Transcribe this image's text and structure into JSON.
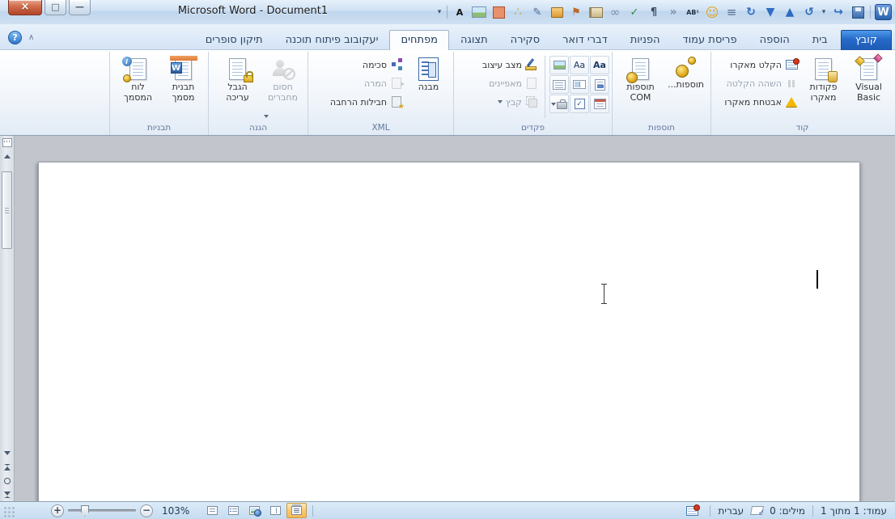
{
  "window": {
    "title": "Microsoft Word - Document1",
    "controls": {
      "close": "×",
      "maximize": "□",
      "minimize": "—"
    }
  },
  "glyphs": {
    "w": "W",
    "aa": "Aa",
    "check": "✓",
    "help": "?",
    "collapse": "∧",
    "plus": "+",
    "minus": "−",
    "i": "i",
    "star": "★"
  },
  "qat": {
    "icons": [
      {
        "name": "toolbar-options",
        "glyph": "▾"
      },
      {
        "name": "font-color",
        "glyph": "A"
      },
      {
        "name": "picture",
        "glyph": ""
      },
      {
        "name": "shape",
        "glyph": ""
      },
      {
        "name": "org-chart",
        "glyph": "∴"
      },
      {
        "name": "ink-signature",
        "glyph": "✎"
      },
      {
        "name": "package",
        "glyph": ""
      },
      {
        "name": "signpost",
        "glyph": "⚑"
      },
      {
        "name": "book",
        "glyph": ""
      },
      {
        "name": "rings",
        "glyph": "∞"
      },
      {
        "name": "hyperlink-check",
        "glyph": "✓"
      },
      {
        "name": "paragraph-marks",
        "glyph": "¶"
      },
      {
        "name": "autotext",
        "glyph": "»"
      },
      {
        "name": "footnote",
        "glyph": "AB¹"
      },
      {
        "name": "emoticon",
        "glyph": "☺"
      },
      {
        "name": "line-spacing",
        "glyph": "≡"
      },
      {
        "name": "sync",
        "glyph": "↻"
      },
      {
        "name": "move-down",
        "glyph": "▼"
      },
      {
        "name": "move-up",
        "glyph": "▲"
      },
      {
        "name": "undo",
        "glyph": "↺"
      },
      {
        "name": "undo-menu",
        "glyph": "▾"
      },
      {
        "name": "redo",
        "glyph": "↪"
      },
      {
        "name": "save",
        "glyph": ""
      }
    ]
  },
  "tabs": [
    {
      "label": "קובץ"
    },
    {
      "label": "בית"
    },
    {
      "label": "הוספה"
    },
    {
      "label": "פריסת עמוד"
    },
    {
      "label": "הפניות"
    },
    {
      "label": "דברי דואר"
    },
    {
      "label": "סקירה"
    },
    {
      "label": "תצוגה"
    },
    {
      "label": "מפתחים",
      "active": true
    },
    {
      "label": "יעקובוב פיתוח תוכנה"
    },
    {
      "label": "תיקון סופרים"
    }
  ],
  "ribbon": {
    "code": {
      "label": "קוד",
      "visual_basic": "Visual Basic",
      "macros": "פקודות מאקרו",
      "record_macro": "הקלט מאקרו",
      "pause_recording": "השהה הקלטה",
      "macro_security": "אבטחת מאקרו"
    },
    "addins": {
      "label": "תוספות",
      "addins": "תוספות...",
      "com_addins": "תוספות COM"
    },
    "controls": {
      "label": "פקדים",
      "design_mode": "מצב עיצוב",
      "properties": "מאפיינים",
      "group": "קבץ"
    },
    "xml": {
      "label": "XML",
      "structure": "מבנה",
      "schema": "סכימה",
      "transformation": "המרה",
      "expansion_packs": "חבילות הרחבה"
    },
    "protection": {
      "label": "הגנה",
      "block_authors": "חסום מחברים",
      "restrict_editing": "הגבל עריכה"
    },
    "templates": {
      "label": "תבניות",
      "document_template": "תבנית מסמך",
      "document_panel": "לוח המסמך"
    }
  },
  "statusbar": {
    "page_info": "עמוד: 1 מתוך 1",
    "words": "מילים: 0",
    "language": "עברית",
    "zoom": "103%"
  },
  "colors": {
    "file_tab_blue": "#2a72cd",
    "close_button_red": "#c75b40",
    "active_view_orange": "#f6c066",
    "ribbon_label_gray": "#62789a"
  }
}
